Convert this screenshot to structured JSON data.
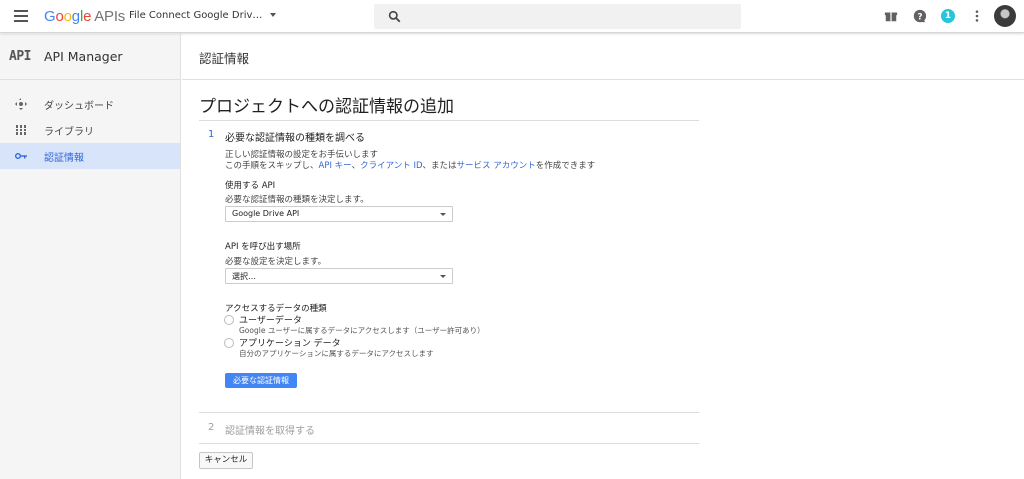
{
  "topbar": {
    "logo_google": "Google",
    "logo_apis": "APIs",
    "project_name": "File Connect Google Driv…",
    "notification_count": "1"
  },
  "sidebar": {
    "logo": "API",
    "title": "API Manager",
    "items": [
      {
        "label": "ダッシュボード",
        "icon": "dashboard-icon"
      },
      {
        "label": "ライブラリ",
        "icon": "library-icon"
      },
      {
        "label": "認証情報",
        "icon": "key-icon",
        "active": true
      }
    ]
  },
  "main": {
    "header_title": "認証情報",
    "page_title": "プロジェクトへの認証情報の追加",
    "step1": {
      "number": "1",
      "title": "必要な認証情報の種類を調べる",
      "intro": "正しい認証情報の設定をお手伝いします",
      "skip_prefix": "この手順をスキップし、",
      "link_api_key": "API キー",
      "sep1": "、",
      "link_client_id": "クライアント ID",
      "sep2": "、または",
      "link_service_account": "サービス アカウント",
      "skip_suffix": "を作成できます",
      "api_label": "使用する API",
      "api_sublabel": "必要な認証情報の種類を決定します。",
      "api_value": "Google Drive API",
      "caller_label": "API を呼び出す場所",
      "caller_sublabel": "必要な設定を決定します。",
      "caller_value": "選択…",
      "data_label": "アクセスするデータの種類",
      "radio_user_label": "ユーザーデータ",
      "radio_user_desc": "Google ユーザーに属するデータにアクセスします（ユーザー許可あり）",
      "radio_app_label": "アプリケーション データ",
      "radio_app_desc": "自分のアプリケーションに属するデータにアクセスします",
      "submit_label": "必要な認証情報"
    },
    "step2": {
      "number": "2",
      "title": "認証情報を取得する"
    },
    "cancel_label": "キャンセル"
  },
  "colors": {
    "accent": "#3367d6",
    "primary_button": "#4285f4",
    "active_nav_bg": "#d7e4fa",
    "badge": "#26c6da"
  }
}
